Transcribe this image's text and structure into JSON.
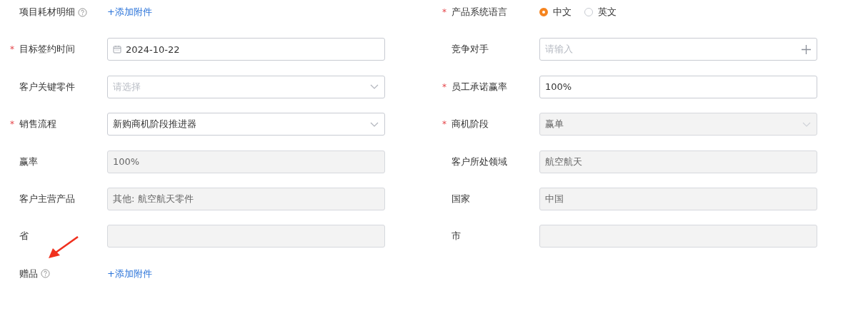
{
  "rows": [
    {
      "left": {
        "kind": "attachment",
        "label": "项目耗材明细",
        "help": true,
        "link": "+添加附件"
      },
      "right": {
        "kind": "radio",
        "label": "产品系统语言",
        "required_mark": "*",
        "options": [
          {
            "label": "中文",
            "selected": true
          },
          {
            "label": "英文",
            "selected": false
          }
        ]
      }
    },
    {
      "left": {
        "kind": "date",
        "label": "目标签约时间",
        "required_mark": "*",
        "value": "2024-10-22",
        "disabled": false
      },
      "right": {
        "kind": "add",
        "label": "竞争对手",
        "placeholder": "请输入",
        "disabled": false
      }
    },
    {
      "left": {
        "kind": "select",
        "label": "客户关键零件",
        "placeholder": "请选择",
        "disabled": false
      },
      "right": {
        "kind": "text",
        "label": "员工承诺赢率",
        "required_mark": "*",
        "value": "100%",
        "disabled": false
      }
    },
    {
      "left": {
        "kind": "select",
        "label": "销售流程",
        "required_mark": "*",
        "value": "新购商机阶段推进器",
        "disabled": false
      },
      "right": {
        "kind": "select",
        "label": "商机阶段",
        "required_mark": "*",
        "value": "赢单",
        "disabled": true
      }
    },
    {
      "left": {
        "kind": "text",
        "label": "赢率",
        "value": "100%",
        "disabled": true
      },
      "right": {
        "kind": "text",
        "label": "客户所处领域",
        "value": "航空航天",
        "disabled": true
      }
    },
    {
      "left": {
        "kind": "text",
        "label": "客户主营产品",
        "value": "其他: 航空航天零件",
        "disabled": true
      },
      "right": {
        "kind": "text",
        "label": "国家",
        "value": "中国",
        "disabled": true
      }
    },
    {
      "left": {
        "kind": "text",
        "label": "省",
        "disabled": true
      },
      "right": {
        "kind": "text",
        "label": "市",
        "disabled": true
      }
    },
    {
      "left": {
        "kind": "attachment",
        "label": "赠品",
        "help": true,
        "link": "+添加附件"
      }
    }
  ]
}
